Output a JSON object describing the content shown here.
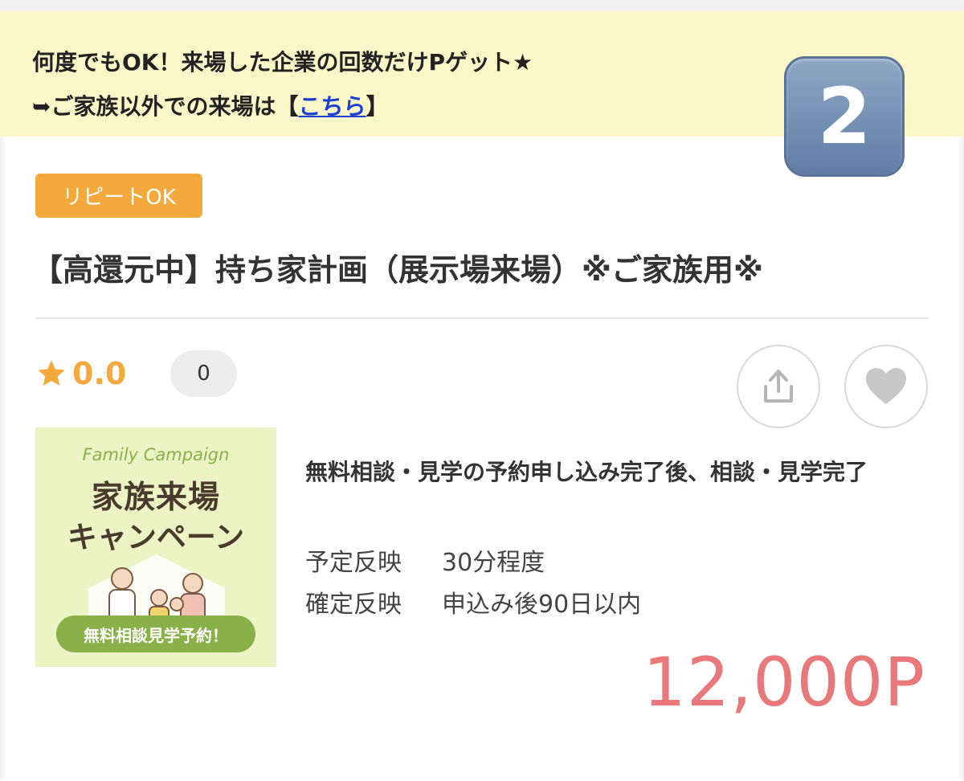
{
  "notice": {
    "line1": "何度でもOK！来場した企業の回数だけPゲット★",
    "line2_prefix": "➥ご家族以外での来場は【",
    "line2_link": "こちら",
    "line2_suffix": "】"
  },
  "badge_number": "2",
  "repeat_tag": "リピートOK",
  "title": "【高還元中】持ち家計画（展示場来場）※ご家族用※",
  "rating": {
    "score": "0.0",
    "review_count": "0",
    "icon": "star-icon"
  },
  "actions": {
    "share_icon": "share-icon",
    "favorite_icon": "heart-icon"
  },
  "banner": {
    "english": "Family Campaign",
    "heading1": "家族来場",
    "heading2": "キャンペーン",
    "pill": "無料相談見学予約！"
  },
  "condition": "無料相談・見学の予約申し込み完了後、相談・見学完了",
  "meta": {
    "scheduled_label": "予定反映",
    "scheduled_value": "30分程度",
    "confirmed_label": "確定反映",
    "confirmed_value": "申込み後90日以内"
  },
  "points": "12,000P",
  "colors": {
    "accent_orange": "#f3a93c",
    "points_red": "#e8787a",
    "notice_bg": "#fbf7c9",
    "link_blue": "#1a3fd1"
  }
}
